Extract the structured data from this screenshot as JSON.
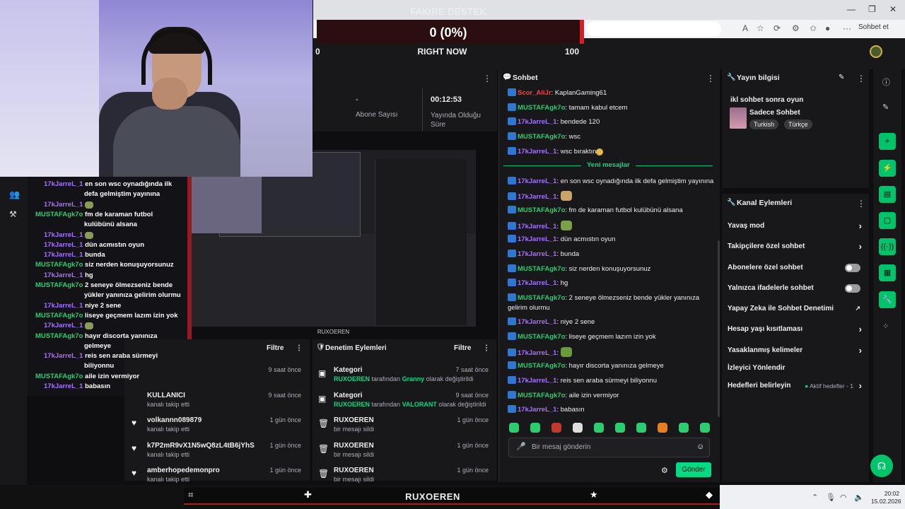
{
  "donation": {
    "title": "FAKIRE DESTEK",
    "value": "0 (0%)",
    "min": "0",
    "label": "RIGHT NOW",
    "max": "100",
    "progress": 0
  },
  "browser": {
    "sohbet_et": "Sohbet et"
  },
  "overlay_chat": [
    {
      "user": "17kJarreL_1",
      "text": "en son wsc oynadığında ilk",
      "color": "#a970ff"
    },
    {
      "user": "",
      "text": "defa gelmiştim yayınına",
      "color": "#a970ff"
    },
    {
      "user": "17kJarreL_1",
      "text": "",
      "color": "#a970ff",
      "emote": true
    },
    {
      "user": "MUSTAFAgk7o",
      "text": "fm de karaman futbol",
      "color": "#2ecc71"
    },
    {
      "user": "",
      "text": "kulübünü alsana",
      "color": "#2ecc71"
    },
    {
      "user": "17kJarreL_1",
      "text": "",
      "color": "#a970ff",
      "emote": true
    },
    {
      "user": "17kJarreL_1",
      "text": "dün acmıstın oyun",
      "color": "#a970ff"
    },
    {
      "user": "17kJarreL_1",
      "text": "bunda",
      "color": "#a970ff"
    },
    {
      "user": "MUSTAFAgk7o",
      "text": "siz nerden konuşuyorsunuz",
      "color": "#2ecc71"
    },
    {
      "user": "17kJarreL_1",
      "text": "hg",
      "color": "#a970ff"
    },
    {
      "user": "MUSTAFAgk7o",
      "text": "2 seneye ölmezseniz bende",
      "color": "#2ecc71"
    },
    {
      "user": "",
      "text": "yükler yanınıza gelirim olurmu",
      "color": "#2ecc71"
    },
    {
      "user": "17kJarreL_1",
      "text": "niye 2 sene",
      "color": "#a970ff"
    },
    {
      "user": "MUSTAFAgk7o",
      "text": "liseye geçmem lazım izin yok",
      "color": "#2ecc71"
    },
    {
      "user": "17kJarreL_1",
      "text": "",
      "color": "#a970ff",
      "emote": true
    },
    {
      "user": "MUSTAFAgk7o",
      "text": "hayır discorta yanınıza",
      "color": "#2ecc71"
    },
    {
      "user": "",
      "text": "gelmeye",
      "color": "#2ecc71"
    },
    {
      "user": "17kJarreL_1",
      "text": "reis sen araba sürmeyi",
      "color": "#a970ff"
    },
    {
      "user": "",
      "text": "biliyonnu",
      "color": "#a970ff"
    },
    {
      "user": "MUSTAFAgk7o",
      "text": "aile izin vermiyor",
      "color": "#2ecc71"
    },
    {
      "user": "17kJarreL_1",
      "text": "babasın",
      "color": "#a970ff"
    }
  ],
  "stats": {
    "dash": "-",
    "subs_label": "Abone Sayısı",
    "uptime": "00:12:53",
    "uptime_label_1": "Yayında Olduğu",
    "uptime_label_2": "Süre"
  },
  "preview": {
    "brand": "RUXOEREN"
  },
  "activity": {
    "filter": "Filtre",
    "rows": [
      {
        "name": "",
        "sub": "",
        "time": "9 saat önce"
      },
      {
        "name": "KULLANICI",
        "sub": "kanalı takip etti",
        "time": "9 saat önce"
      },
      {
        "name": "volkannn089879",
        "sub": "kanalı takip etti",
        "time": "1 gün önce"
      },
      {
        "name": "k7P2mR9vX1N5wQ8zL4tB6jYhS",
        "sub": "kanalı takip etti",
        "time": "1 gün önce"
      },
      {
        "name": "amberhopedemonpro",
        "sub": "kanalı takip etti",
        "time": "1 gün önce"
      }
    ]
  },
  "modlog": {
    "title": "Denetim Eylemleri",
    "filter": "Filtre",
    "rows": [
      {
        "name": "Kategori",
        "by": "RUXOEREN",
        "mid": " tarafından ",
        "val": "Granny",
        "tail": " olarak değiştirildi",
        "time": "7 saat önce",
        "icon": "category-icon"
      },
      {
        "name": "Kategori",
        "by": "RUXOEREN",
        "mid": " tarafından ",
        "val": "VALORANT",
        "tail": " olarak değiştirildi",
        "time": "9 saat önce",
        "icon": "category-icon"
      },
      {
        "name": "RUXOEREN",
        "sub": "bir mesajı sildi",
        "time": "1 gün önce",
        "icon": "trash-icon"
      },
      {
        "name": "RUXOEREN",
        "sub": "bir mesajı sildi",
        "time": "1 gün önce",
        "icon": "trash-icon"
      },
      {
        "name": "RUXOEREN",
        "sub": "bir mesajı sildi",
        "time": "1 gün önce",
        "icon": "trash-icon"
      }
    ]
  },
  "chat": {
    "title": "Sohbet",
    "new_messages": "Yeni mesajlar",
    "placeholder": "Bir mesaj gönderin",
    "send": "Gönder",
    "messages": [
      {
        "user": "Scor_AliJr",
        "text": "KaplanGaming61",
        "color": "#ff4040"
      },
      {
        "user": "MUSTAFAgk7o",
        "text": "tamam kabul etcem",
        "color": "#2ecc71"
      },
      {
        "user": "17kJarreL_1",
        "text": "bendede 120",
        "color": "#a970ff"
      },
      {
        "user": "MUSTAFAgk7o",
        "text": "wsc",
        "color": "#2ecc71"
      },
      {
        "user": "17kJarreL_1",
        "text": "wsc bıraktın",
        "color": "#a970ff",
        "emoji": true
      },
      {
        "user": "17kJarreL_1",
        "text": "en son wsc oynadığında ilk defa gelmiştim yayınına",
        "color": "#a970ff"
      },
      {
        "user": "17kJarreL_1",
        "text": "",
        "color": "#a970ff",
        "emote": "#c9a46a"
      },
      {
        "user": "MUSTAFAgk7o",
        "text": "fm de karaman futbol kulübünü alsana",
        "color": "#2ecc71"
      },
      {
        "user": "17kJarreL_1",
        "text": "",
        "color": "#a970ff",
        "emote": "#7aa04a"
      },
      {
        "user": "17kJarreL_1",
        "text": "dün acmıstın oyun",
        "color": "#a970ff"
      },
      {
        "user": "17kJarreL_1",
        "text": "bunda",
        "color": "#a970ff"
      },
      {
        "user": "MUSTAFAgk7o",
        "text": "siz nerden konuşuyorsunuz",
        "color": "#2ecc71"
      },
      {
        "user": "17kJarreL_1",
        "text": "hg",
        "color": "#a970ff"
      },
      {
        "user": "MUSTAFAgk7o",
        "text": "2 seneye ölmezseniz bende yükler yanınıza gelirim olurmu",
        "color": "#2ecc71"
      },
      {
        "user": "17kJarreL_1",
        "text": "niye 2 sene",
        "color": "#a970ff"
      },
      {
        "user": "MUSTAFAgk7o",
        "text": "liseye geçmem lazım izin yok",
        "color": "#2ecc71"
      },
      {
        "user": "17kJarreL_1",
        "text": "",
        "color": "#a970ff",
        "emote": "#6a9a3a"
      },
      {
        "user": "MUSTAFAgk7o",
        "text": "hayır discorta yanınıza gelmeye",
        "color": "#2ecc71"
      },
      {
        "user": "17kJarreL_1",
        "text": "reis sen araba sürmeyi biliyonnu",
        "color": "#a970ff"
      },
      {
        "user": "MUSTAFAgk7o",
        "text": "aile izin vermiyor",
        "color": "#2ecc71"
      },
      {
        "user": "17kJarreL_1",
        "text": "babasın",
        "color": "#a970ff"
      }
    ]
  },
  "stream_info": {
    "title": "Yayın bilgisi",
    "stream_title": "ikl sohbet sonra oyun",
    "category": "Sadece Sohbet",
    "tags": [
      "Turkish",
      "Türkçe"
    ]
  },
  "channel_actions": {
    "title": "Kanal Eylemleri",
    "items": [
      {
        "label": "Yavaş mod",
        "kind": "chevron"
      },
      {
        "label": "Takipçilere özel sohbet",
        "kind": "chevron"
      },
      {
        "label": "Abonelere özel sohbet",
        "kind": "toggle"
      },
      {
        "label": "Yalnızca ifadelerle sohbet",
        "kind": "toggle"
      },
      {
        "label": "Yapay Zeka ile Sohbet Denetimi",
        "kind": "external"
      },
      {
        "label": "Hesap yaşı kısıtlaması",
        "kind": "chevron"
      },
      {
        "label": "Yasaklanmış kelimeler",
        "kind": "chevron"
      },
      {
        "label": "İzleyici Yönlendir",
        "kind": "none"
      },
      {
        "label": "Hedefleri belirleyin",
        "kind": "chevron",
        "extra": "Aktif hedefler - 1"
      }
    ]
  },
  "game_bar": {
    "brand": "RUXOEREN"
  },
  "taskbar": {
    "time": "20:02",
    "date": "15.02.2026"
  },
  "colors": {
    "accent": "#00db84",
    "panel": "#18181b",
    "bg": "#0e0e10",
    "donate_red": "#d0202a"
  }
}
